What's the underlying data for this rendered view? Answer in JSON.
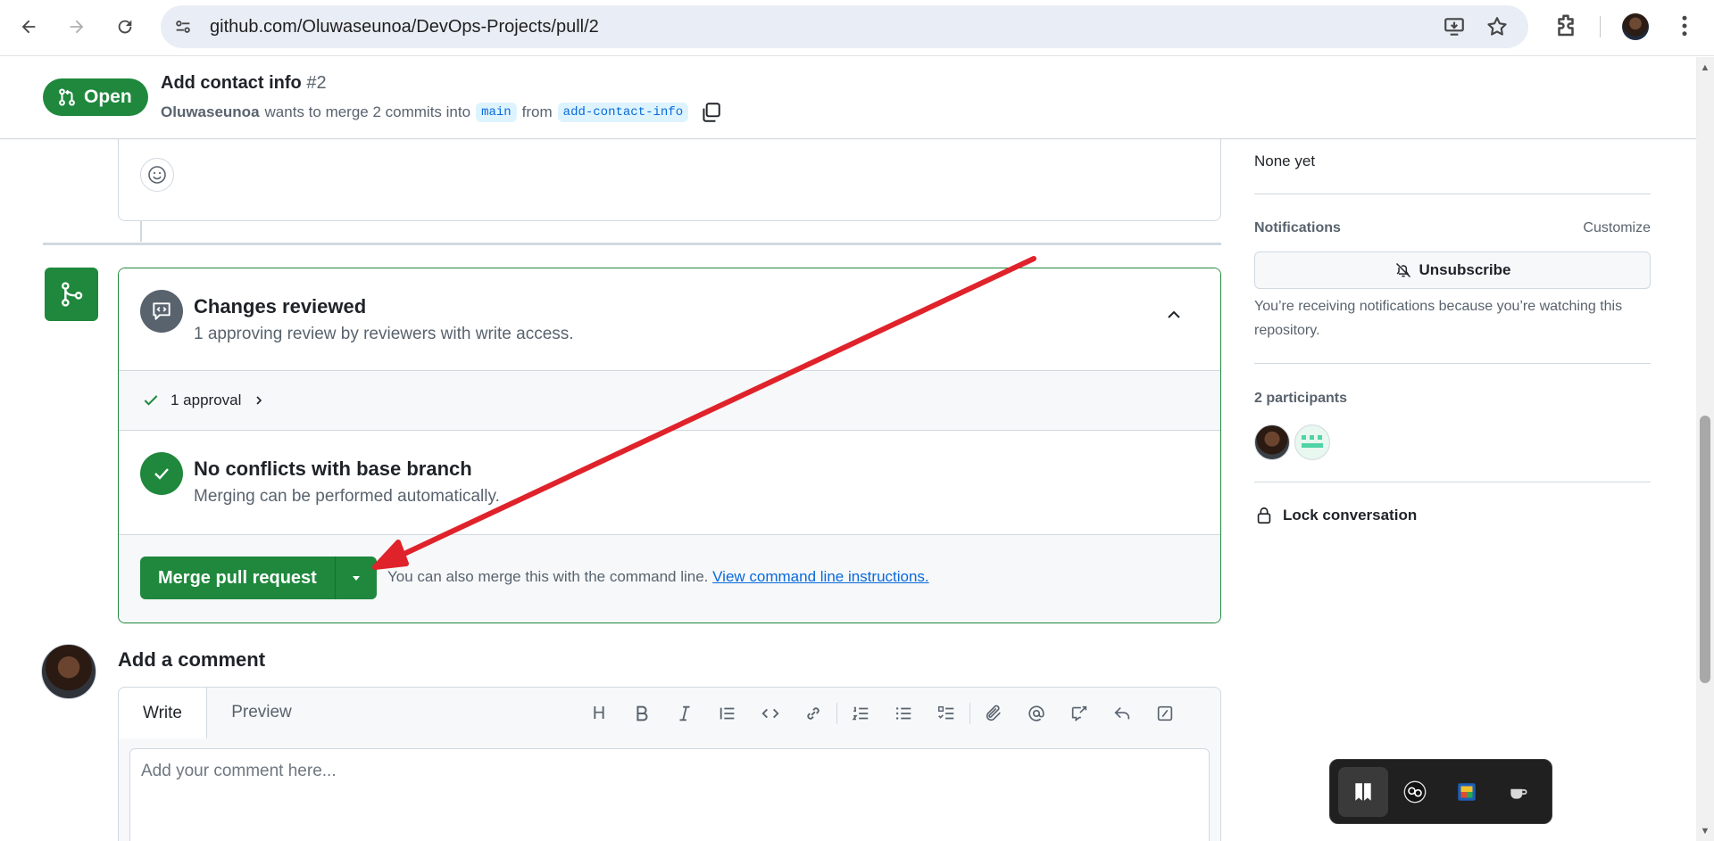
{
  "browser": {
    "url": "github.com/Oluwaseunoa/DevOps-Projects/pull/2"
  },
  "pr": {
    "state": "Open",
    "title": "Add contact info",
    "number": "#2",
    "author": "Oluwaseunoa",
    "merge_text": "wants to merge 2 commits into",
    "base_branch": "main",
    "from_text": "from",
    "head_branch": "add-contact-info"
  },
  "merge_box": {
    "review_title": "Changes reviewed",
    "review_sub": "1 approving review by reviewers with write access.",
    "approval_label": "1 approval",
    "conflict_title": "No conflicts with base branch",
    "conflict_sub": "Merging can be performed automatically.",
    "merge_button": "Merge pull request",
    "cli_text": "You can also merge this with the command line.",
    "cli_link": "View command line instructions."
  },
  "comment": {
    "heading": "Add a comment",
    "tab_write": "Write",
    "tab_preview": "Preview",
    "placeholder": "Add your comment here...",
    "toolbar_heading": "H"
  },
  "sidebar": {
    "milestone_value": "None yet",
    "notifications_title": "Notifications",
    "customize": "Customize",
    "unsubscribe": "Unsubscribe",
    "notification_note": "You’re receiving notifications because you’re watching this repository.",
    "participants_title": "2 participants",
    "lock": "Lock conversation"
  },
  "colors": {
    "green": "#1f883d",
    "link": "#0969da",
    "annotation_arrow": "#e0222a"
  }
}
